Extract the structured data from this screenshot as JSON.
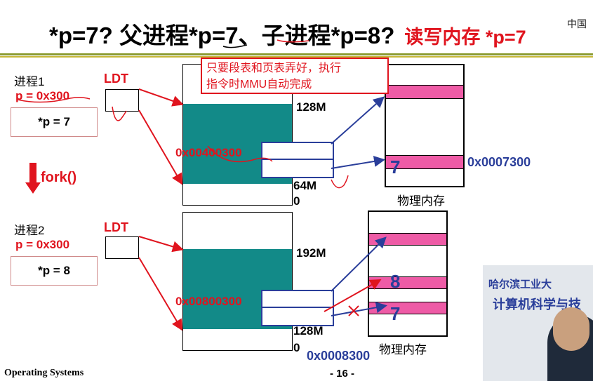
{
  "title": {
    "main": "*p=7? 父进程*p=7、子进程*p=8?",
    "red": "读写内存 *p=7"
  },
  "logo_text": "中国",
  "callout": {
    "line1": "只要段表和页表弄好，执行",
    "line2": "指令时MMU自动完成"
  },
  "process1": {
    "title": "进程1",
    "p_value": "p = 0x300",
    "deref": "*p = 7",
    "ldt": "LDT",
    "linear_addr": "0x00400300",
    "top_label": "128M",
    "bottom_label": "64M",
    "zero_label": "0",
    "phys_label": "物理内存",
    "phys_value": "7",
    "phys_addr": "0x0007300"
  },
  "fork_label": "fork()",
  "process2": {
    "title": "进程2",
    "p_value": "p = 0x300",
    "deref": "*p = 8",
    "ldt": "LDT",
    "linear_addr": "0x00800300",
    "top_label": "192M",
    "bottom_label": "128M",
    "zero_label": "0",
    "phys_label": "物理内存",
    "phys_value_new": "8",
    "phys_value_old": "7",
    "phys_addr": "0x0008300"
  },
  "footer": {
    "left": "Operating Systems",
    "page": "- 16 -"
  },
  "video": {
    "sign1": "哈尔滨工业大",
    "sign2": "计算机科学与技"
  },
  "colors": {
    "accent_red": "#e0141e",
    "teal": "#128a88",
    "pink": "#ee5ba6",
    "blue": "#2a3e9a"
  }
}
